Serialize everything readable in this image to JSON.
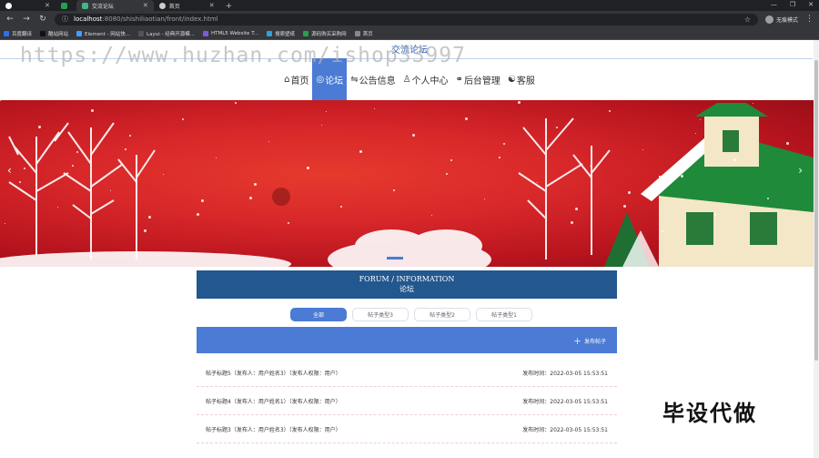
{
  "browser": {
    "tabs": [
      {
        "title": "",
        "active": false
      },
      {
        "title": "",
        "active": false
      },
      {
        "title": "交流论坛",
        "active": true
      },
      {
        "title": "首页",
        "active": false
      }
    ],
    "url_host": "localhost",
    "url_path": ":8080/shishiliaotian/front/index.html",
    "profile_label": "无痕模式",
    "bookmarks": [
      {
        "label": "百度翻译",
        "color": "#2f6fe8"
      },
      {
        "label": "酷站网站",
        "color": "#111111"
      },
      {
        "label": "Element - 网站快...",
        "color": "#409eff"
      },
      {
        "label": "Layui - 经典开源模...",
        "color": "#555555"
      },
      {
        "label": "HTML5 Website T...",
        "color": "#7b5cd6"
      },
      {
        "label": "搜索壁纸",
        "color": "#2aa4d8"
      },
      {
        "label": "源码购买采购网",
        "color": "#22a34a"
      },
      {
        "label": "首页",
        "color": "#888888"
      }
    ]
  },
  "watermark": "https://www.huzhan.com/ishop33997",
  "site": {
    "title": "交流论坛",
    "menu": [
      {
        "icon": "⌂",
        "label": "首页",
        "active": false
      },
      {
        "icon": "◎",
        "label": "论坛",
        "active": true
      },
      {
        "icon": "⇋",
        "label": "公告信息",
        "active": false
      },
      {
        "icon": "♙",
        "label": "个人中心",
        "active": false
      },
      {
        "icon": "⚭",
        "label": "后台管理",
        "active": false
      },
      {
        "icon": "☯",
        "label": "客服",
        "active": false
      }
    ]
  },
  "forum": {
    "title_en": "FORUM / INFORMATION",
    "title_cn": "论坛",
    "filters": [
      {
        "label": "全部",
        "active": true
      },
      {
        "label": "帖子类型3",
        "active": false
      },
      {
        "label": "帖子类型2",
        "active": false
      },
      {
        "label": "帖子类型1",
        "active": false
      }
    ],
    "post_button": "发布帖子",
    "posts": [
      {
        "title": "帖子标题5（发布人：用户姓名3）（发布人权限：用户）",
        "time": "发布时间：2022-03-05 15:53:51"
      },
      {
        "title": "帖子标题4（发布人：用户姓名1）（发布人权限：用户）",
        "time": "发布时间：2022-03-05 15:53:51"
      },
      {
        "title": "帖子标题3（发布人：用户姓名3）（发布人权限：用户）",
        "time": "发布时间：2022-03-05 15:53:51"
      }
    ]
  },
  "promo": "毕设代做",
  "colors": {
    "accent": "#4b7bd4",
    "forum_header": "#23578f",
    "banner_red": "#d8282a"
  }
}
